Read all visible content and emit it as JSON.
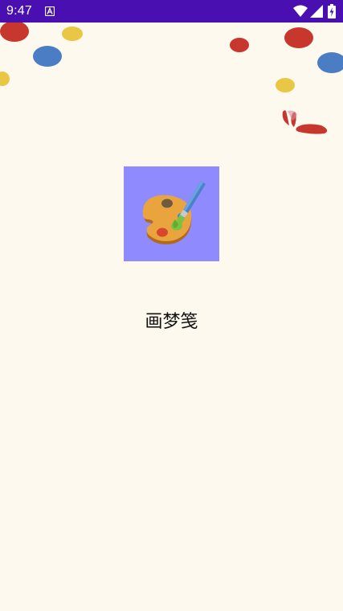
{
  "status_bar": {
    "time": "9:47",
    "background_color": "#4a0fb0",
    "icons": [
      "notification-a-icon",
      "wifi-icon",
      "signal-icon",
      "battery-charging-icon"
    ]
  },
  "splash": {
    "app_name": "画梦笺",
    "background_color": "#fdf9ee",
    "icon": "palette-brush-icon",
    "icon_background_color": "#8f8bff"
  },
  "decoration": {
    "confetti_colors": [
      "#c8372d",
      "#e9c744",
      "#4a7dc4"
    ]
  }
}
